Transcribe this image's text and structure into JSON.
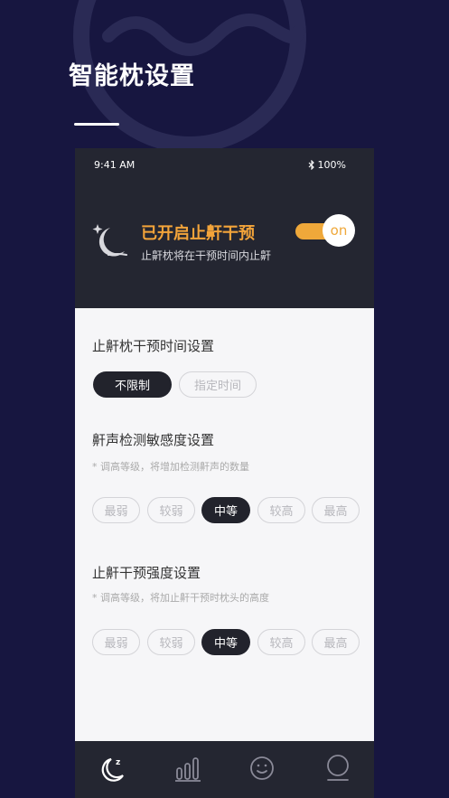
{
  "page": {
    "title": "智能枕设置"
  },
  "status_bar": {
    "time": "9:41 AM",
    "battery": "100%",
    "bluetooth_icon": "bluetooth-icon"
  },
  "snore_status": {
    "title": "已开启止鼾干预",
    "subtitle": "止鼾枕将在干预时间内止鼾",
    "toggle_label": "on",
    "toggle_on": true,
    "accent_color": "#f3a43a"
  },
  "time_setting": {
    "title": "止鼾枕干预时间设置",
    "options": [
      "不限制",
      "指定时间"
    ],
    "selected": "不限制"
  },
  "sensitivity": {
    "title": "鼾声检测敏感度设置",
    "note": "* 调高等级，将增加检测鼾声的数量",
    "options": [
      "最弱",
      "较弱",
      "中等",
      "较高",
      "最高"
    ],
    "selected": "中等"
  },
  "intensity": {
    "title": "止鼾干预强度设置",
    "note": "* 调高等级，将加止鼾干预时枕头的高度",
    "options": [
      "最弱",
      "较弱",
      "中等",
      "较高",
      "最高"
    ],
    "selected": "中等"
  },
  "tabbar": {
    "tabs": [
      "moon-sleep-icon",
      "bar-chart-icon",
      "smiley-icon",
      "profile-icon"
    ],
    "active": "moon-sleep-icon"
  }
}
